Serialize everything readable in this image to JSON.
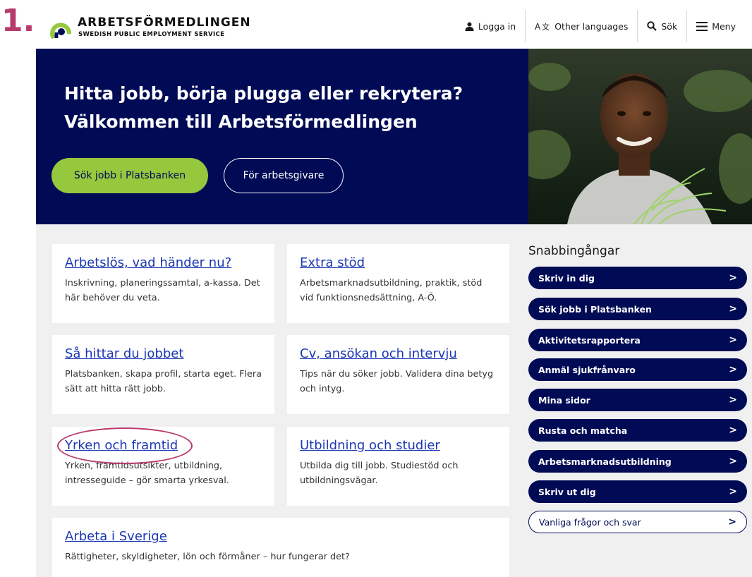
{
  "step_marker": "1.",
  "header": {
    "logo_title": "ARBETSFÖRMEDLINGEN",
    "logo_subtitle": "SWEDISH PUBLIC EMPLOYMENT SERVICE",
    "nav": {
      "login": "Logga in",
      "languages": "Other languages",
      "search": "Sök",
      "menu": "Meny"
    }
  },
  "hero": {
    "title_line1": "Hitta jobb, börja plugga eller rekrytera?",
    "title_line2": "Välkommen till Arbetsförmedlingen",
    "primary_button": "Sök jobb i Platsbanken",
    "secondary_button": "För arbetsgivare"
  },
  "cards": [
    {
      "title": "Arbetslös, vad händer nu?",
      "desc": "Inskrivning, planeringssamtal, a-kassa. Det här behöver du veta."
    },
    {
      "title": "Extra stöd",
      "desc": "Arbetsmarknadsutbildning, praktik, stöd vid funktionsnedsättning, A-Ö."
    },
    {
      "title": "Så hittar du jobbet",
      "desc": "Platsbanken, skapa profil, starta eget. Flera sätt att hitta rätt jobb."
    },
    {
      "title": "Cv, ansökan och intervju",
      "desc": "Tips när du söker jobb. Validera dina betyg och intyg."
    },
    {
      "title": "Yrken och framtid",
      "desc": "Yrken, framtidsutsikter, utbildning, intresseguide – gör smarta yrkesval."
    },
    {
      "title": "Utbildning och studier",
      "desc": "Utbilda dig till jobb. Studiestöd och utbildningsvägar."
    },
    {
      "title": "Arbeta i Sverige",
      "desc": "Rättigheter, skyldigheter, lön och förmåner – hur fungerar det?"
    }
  ],
  "quick_links": {
    "title": "Snabbingångar",
    "items": [
      "Skriv in dig",
      "Sök jobb i Platsbanken",
      "Aktivitetsrapportera",
      "Anmäl sjukfrånvaro",
      "Mina sidor",
      "Rusta och matcha",
      "Arbetsmarknadsutbildning",
      "Skriv ut dig",
      "Vanliga frågor och svar"
    ]
  },
  "colors": {
    "navy": "#000a55",
    "green": "#95c83d",
    "link": "#1c38b4",
    "annotation": "#b83b6d"
  }
}
